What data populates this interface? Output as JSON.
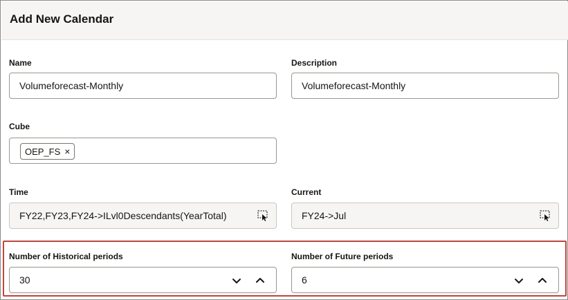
{
  "dialog": {
    "title": "Add New Calendar"
  },
  "form": {
    "name": {
      "label": "Name",
      "value": "Volumeforecast-Monthly"
    },
    "description": {
      "label": "Description",
      "value": "Volumeforecast-Monthly"
    },
    "cube": {
      "label": "Cube",
      "chips": [
        "OEP_FS"
      ],
      "chip_remove_glyph": "×"
    },
    "time": {
      "label": "Time",
      "value": "FY22,FY23,FY24->ILvl0Descendants(YearTotal)"
    },
    "current": {
      "label": "Current",
      "value": "FY24->Jul"
    },
    "historical_periods": {
      "label": "Number of Historical periods",
      "value": "30"
    },
    "future_periods": {
      "label": "Number of Future periods",
      "value": "6"
    }
  },
  "icons": {
    "member_picker": "member-selector-icon",
    "decrement": "chevron-down-icon",
    "increment": "chevron-up-icon",
    "remove": "close-icon"
  },
  "colors": {
    "header_bg": "#f6f5f3",
    "highlight_border": "#c0453a",
    "field_border": "#9a968f",
    "readonly_bg": "#f6f5f3"
  }
}
